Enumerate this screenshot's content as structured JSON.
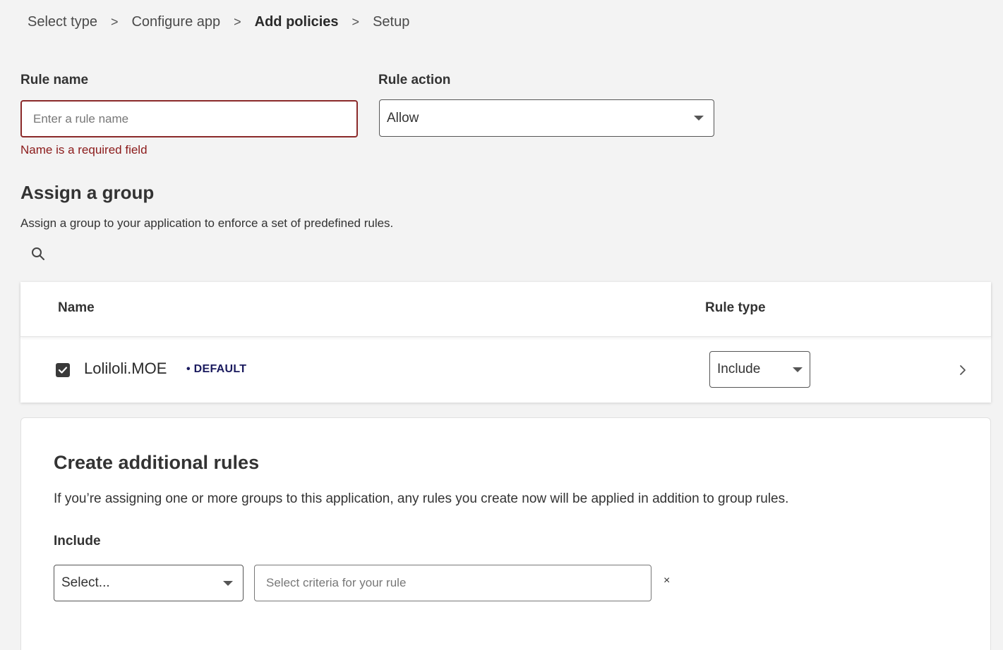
{
  "breadcrumb": {
    "items": [
      "Select type",
      "Configure app",
      "Add policies",
      "Setup"
    ],
    "separator": ">"
  },
  "rule_name": {
    "label": "Rule name",
    "placeholder": "Enter a rule name",
    "value": "",
    "error": "Name is a required field"
  },
  "rule_action": {
    "label": "Rule action",
    "selected": "Allow"
  },
  "assign_group": {
    "title": "Assign a group",
    "description": "Assign a group to your application to enforce a set of predefined rules."
  },
  "group_table": {
    "columns": [
      "Name",
      "Rule type"
    ],
    "rows": [
      {
        "name": "Loliloli.MOE",
        "badge": "• DEFAULT",
        "checked": true,
        "rule_type": "Include"
      }
    ]
  },
  "additional_rules": {
    "title": "Create additional rules",
    "description": "If you’re assigning one or more groups to this application, any rules you create now will be applied in addition to group rules.",
    "include_label": "Include",
    "select_placeholder": "Select...",
    "criteria_placeholder": "Select criteria for your rule",
    "clear_symbol": "×"
  },
  "icons": {
    "search": "search-icon",
    "dropdown": "caret-down-icon",
    "chevron": "chevron-right-icon",
    "check": "check-icon",
    "close": "close-icon"
  },
  "colors": {
    "background": "#f3f3f3",
    "error": "#8b1a1a",
    "badge": "#1a1a5e",
    "checkbox": "#3a3a3a"
  }
}
